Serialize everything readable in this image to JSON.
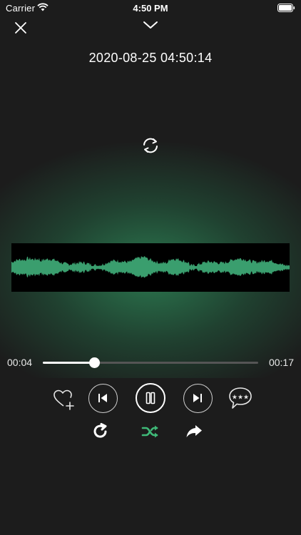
{
  "status_bar": {
    "carrier": "Carrier",
    "time": "4:50 PM"
  },
  "icons": {
    "close": "close-icon",
    "collapse": "chevron-down-icon",
    "convert": "refresh-icon",
    "favorite": "heart-plus-icon",
    "previous": "skip-previous-icon",
    "pause": "pause-icon",
    "next": "skip-next-icon",
    "comment": "speech-bubble-icon",
    "repeat": "repeat-icon",
    "shuffle": "shuffle-icon",
    "share": "share-icon"
  },
  "recording": {
    "title": "2020-08-25 04:50:14"
  },
  "player": {
    "current_time": "00:04",
    "total_time": "00:17",
    "progress": 0.24,
    "shuffle_active": true
  },
  "colors": {
    "accent": "#3fb978",
    "waveform": "#3a9e6e",
    "background": "#1c1c1c"
  }
}
